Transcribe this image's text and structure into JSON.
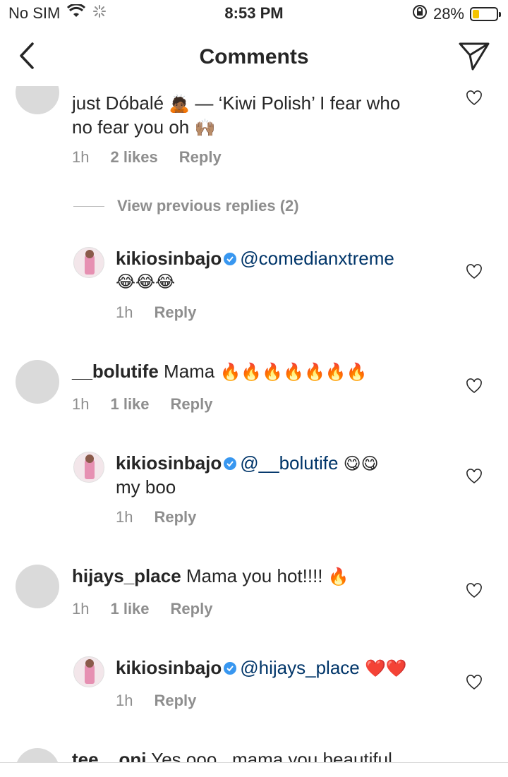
{
  "status_bar": {
    "carrier": "No SIM",
    "time": "8:53 PM",
    "battery_percent": "28%",
    "battery_level": 0.28,
    "battery_color": "#f5c400"
  },
  "nav": {
    "title": "Comments",
    "back_icon": "chevron-left-icon",
    "send_icon": "paper-plane-icon"
  },
  "comments": [
    {
      "line1_pre": "just Dóbalé ",
      "line1_emoji": "🙇🏾",
      "line1_post": " — ‘Kiwi Polish’ I fear who",
      "line2_text": "no fear you oh ",
      "line2_emoji": "🙌🏽",
      "time": "1h",
      "likes": "2 likes",
      "reply": "Reply"
    },
    {
      "view_previous": "View previous replies (2)"
    },
    {
      "username": "kikiosinbajo",
      "mention": "@comedianxtreme",
      "line2_emoji": "😂😂😂",
      "time": "1h",
      "reply": "Reply"
    },
    {
      "username": "__bolutife",
      "text": "Mama",
      "emoji": "🔥🔥🔥🔥🔥🔥🔥",
      "time": "1h",
      "likes": "1 like",
      "reply": "Reply"
    },
    {
      "username": "kikiosinbajo",
      "mention": "@__bolutife",
      "emoji": "😋😋",
      "line2_text": "my boo",
      "time": "1h",
      "reply": "Reply"
    },
    {
      "username": "hijays_place",
      "text": "Mama you hot!!!!",
      "emoji": "🔥",
      "time": "1h",
      "likes": "1 like",
      "reply": "Reply"
    },
    {
      "username": "kikiosinbajo",
      "mention": "@hijays_place",
      "emoji": "❤️❤️",
      "time": "1h",
      "reply": "Reply"
    },
    {
      "username": "tee__oni",
      "text": "Yes ooo.. mama you beautiful"
    }
  ]
}
